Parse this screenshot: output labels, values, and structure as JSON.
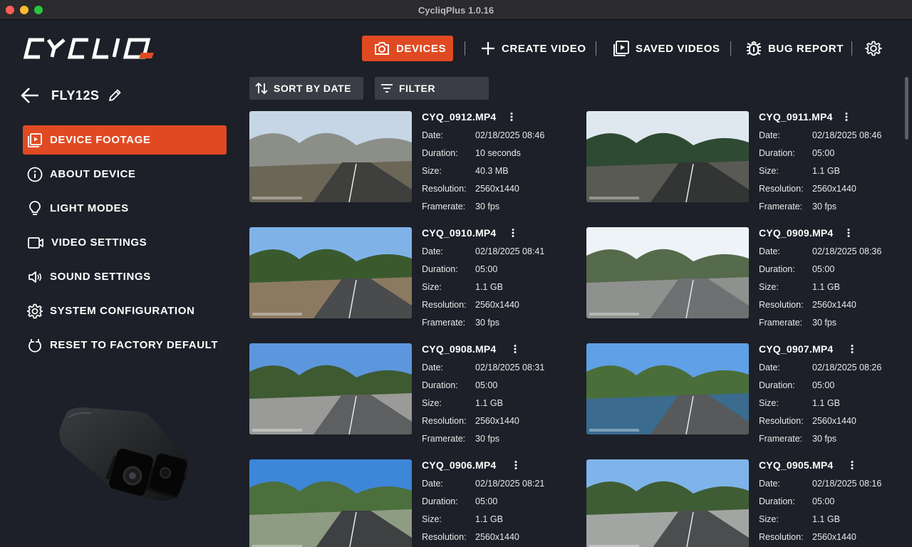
{
  "window": {
    "title": "CycliqPlus 1.0.16"
  },
  "brand": {
    "logo_text": "CYCLIQ",
    "accent": "#e04a23"
  },
  "nav": {
    "devices": "DEVICES",
    "create_video": "CREATE VIDEO",
    "saved_videos": "SAVED VIDEOS",
    "bug_report": "BUG REPORT",
    "settings_icon": "gear-icon"
  },
  "device": {
    "name": "FLY12S"
  },
  "sidebar": {
    "items": [
      {
        "label": "DEVICE FOOTAGE",
        "icon": "play-library-icon",
        "active": true
      },
      {
        "label": "ABOUT DEVICE",
        "icon": "info-icon",
        "active": false
      },
      {
        "label": "LIGHT MODES",
        "icon": "bulb-icon",
        "active": false
      },
      {
        "label": "VIDEO SETTINGS",
        "icon": "video-camera-icon",
        "active": false
      },
      {
        "label": "SOUND SETTINGS",
        "icon": "speaker-icon",
        "active": false
      },
      {
        "label": "SYSTEM CONFIGURATION",
        "icon": "gear-icon",
        "active": false
      },
      {
        "label": "RESET TO FACTORY DEFAULT",
        "icon": "reset-icon",
        "active": false
      }
    ]
  },
  "toolbar": {
    "sort": "SORT BY DATE",
    "filter": "FILTER"
  },
  "labels": {
    "date": "Date:",
    "duration": "Duration:",
    "size": "Size:",
    "resolution": "Resolution:",
    "framerate": "Framerate:"
  },
  "videos": [
    {
      "name": "CYQ_0912.MP4",
      "date": "02/18/2025 08:46",
      "duration": "10 seconds",
      "size": "40.3 MB",
      "resolution": "2560x1440",
      "framerate": "30 fps"
    },
    {
      "name": "CYQ_0911.MP4",
      "date": "02/18/2025 08:46",
      "duration": "05:00",
      "size": "1.1 GB",
      "resolution": "2560x1440",
      "framerate": "30 fps"
    },
    {
      "name": "CYQ_0910.MP4",
      "date": "02/18/2025 08:41",
      "duration": "05:00",
      "size": "1.1 GB",
      "resolution": "2560x1440",
      "framerate": "30 fps"
    },
    {
      "name": "CYQ_0909.MP4",
      "date": "02/18/2025 08:36",
      "duration": "05:00",
      "size": "1.1 GB",
      "resolution": "2560x1440",
      "framerate": "30 fps"
    },
    {
      "name": "CYQ_0908.MP4",
      "date": "02/18/2025 08:31",
      "duration": "05:00",
      "size": "1.1 GB",
      "resolution": "2560x1440",
      "framerate": "30 fps"
    },
    {
      "name": "CYQ_0907.MP4",
      "date": "02/18/2025 08:26",
      "duration": "05:00",
      "size": "1.1 GB",
      "resolution": "2560x1440",
      "framerate": "30 fps"
    },
    {
      "name": "CYQ_0906.MP4",
      "date": "02/18/2025 08:21",
      "duration": "05:00",
      "size": "1.1 GB",
      "resolution": "2560x1440",
      "framerate": ""
    },
    {
      "name": "CYQ_0905.MP4",
      "date": "02/18/2025 08:16",
      "duration": "05:00",
      "size": "1.1 GB",
      "resolution": "2560x1440",
      "framerate": ""
    }
  ]
}
